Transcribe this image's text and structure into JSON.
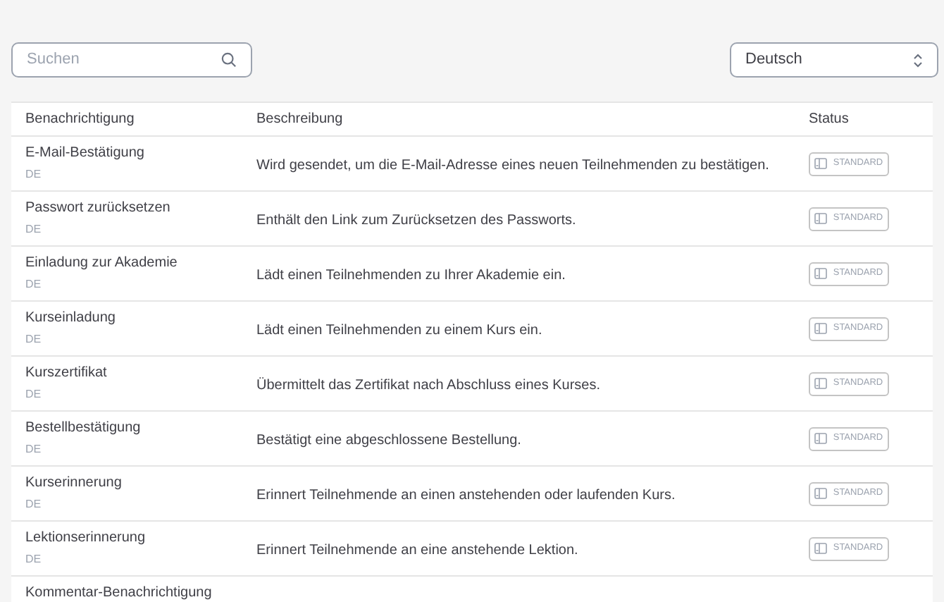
{
  "search": {
    "placeholder": "Suchen"
  },
  "language_select": {
    "value": "Deutsch"
  },
  "table": {
    "columns": [
      "Benachrichtigung",
      "Beschreibung",
      "Status"
    ],
    "rows": [
      {
        "name": "E-Mail-Bestätigung",
        "language": "DE",
        "description": "Wird gesendet, um die E-Mail-Adresse eines neuen Teilnehmenden zu bestätigen.",
        "status": "STANDARD"
      },
      {
        "name": "Passwort zurücksetzen",
        "language": "DE",
        "description": "Enthält den Link zum Zurücksetzen des Passworts.",
        "status": "STANDARD"
      },
      {
        "name": "Einladung zur Akademie",
        "language": "DE",
        "description": "Lädt einen Teilnehmenden zu Ihrer Akademie ein.",
        "status": "STANDARD"
      },
      {
        "name": "Kurseinladung",
        "language": "DE",
        "description": "Lädt einen Teilnehmenden zu einem Kurs ein.",
        "status": "STANDARD"
      },
      {
        "name": "Kurszertifikat",
        "language": "DE",
        "description": "Übermittelt das Zertifikat nach Abschluss eines Kurses.",
        "status": "STANDARD"
      },
      {
        "name": "Bestellbestätigung",
        "language": "DE",
        "description": "Bestätigt eine abgeschlossene Bestellung.",
        "status": "STANDARD"
      },
      {
        "name": "Kurserinnerung",
        "language": "DE",
        "description": "Erinnert Teilnehmende an einen anstehenden oder laufenden Kurs.",
        "status": "STANDARD"
      },
      {
        "name": "Lektionserinnerung",
        "language": "DE",
        "description": "Erinnert Teilnehmende an eine anstehende Lektion.",
        "status": "STANDARD"
      },
      {
        "name": "Kommentar-Benachrichtigung"
      }
    ]
  }
}
